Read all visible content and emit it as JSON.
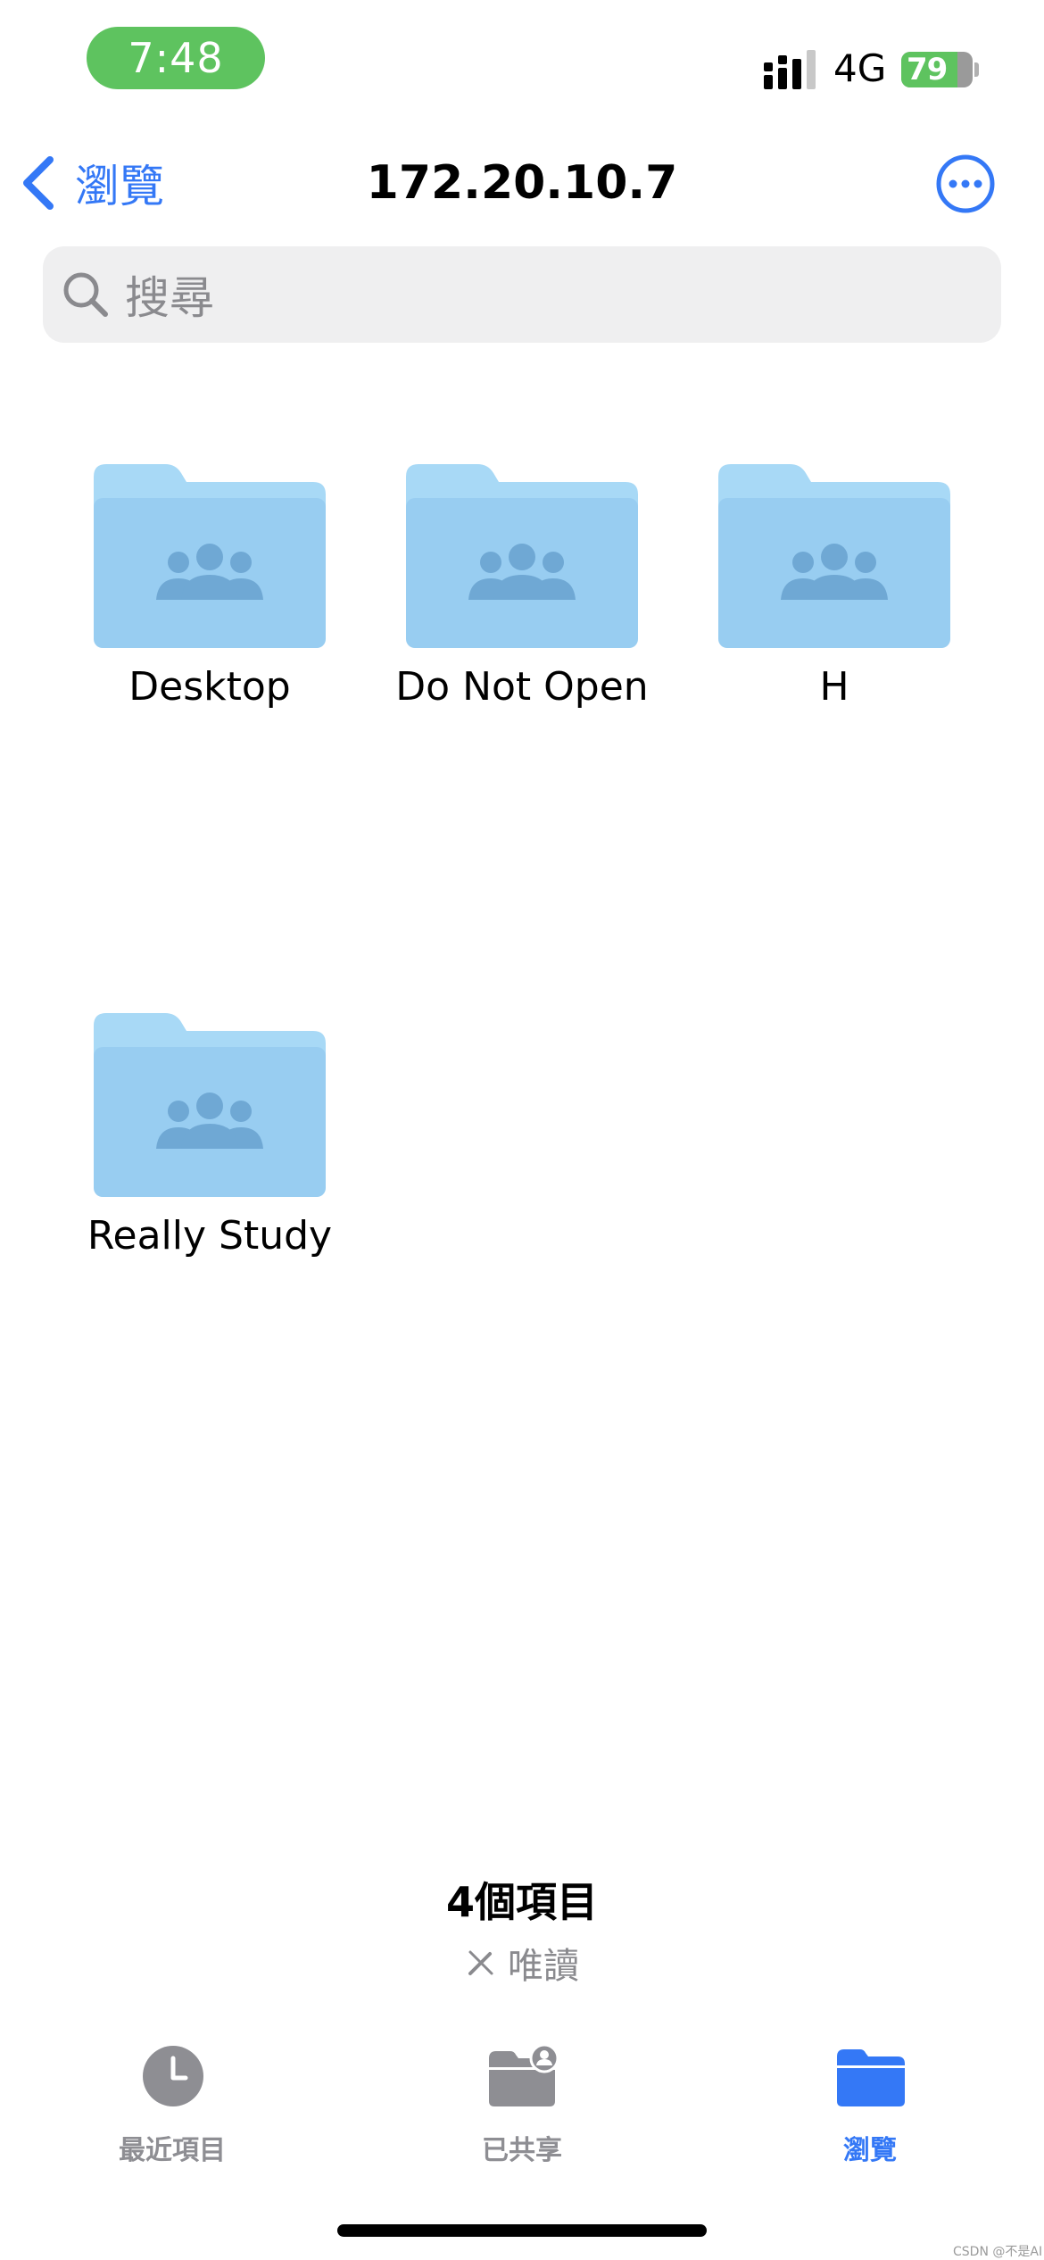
{
  "status_bar": {
    "time": "7:48",
    "network": "4G",
    "battery_percent": 79,
    "battery_label": "79",
    "colors": {
      "time_pill": "#5ec35f",
      "battery": "#5ec35f"
    }
  },
  "nav": {
    "back_label": "瀏覽",
    "title": "172.20.10.7",
    "more_icon": "ellipsis-circle-icon"
  },
  "search": {
    "placeholder": "搜尋"
  },
  "folders": [
    {
      "name": "Desktop",
      "icon": "shared-folder-icon"
    },
    {
      "name": "Do Not Open",
      "icon": "shared-folder-icon"
    },
    {
      "name": "H",
      "icon": "shared-folder-icon"
    },
    {
      "name": "Really Study",
      "icon": "shared-folder-icon"
    }
  ],
  "footer": {
    "items_count": "4個項目",
    "read_only": "唯讀"
  },
  "tab_bar": {
    "tabs": [
      {
        "label": "最近項目",
        "icon": "clock-icon",
        "active": false
      },
      {
        "label": "已共享",
        "icon": "shared-folder-icon",
        "active": false
      },
      {
        "label": "瀏覽",
        "icon": "folder-icon",
        "active": true
      }
    ]
  },
  "watermark": "CSDN @不是AI",
  "theme": {
    "accent": "#3478f6",
    "folder_back": "#a6d7f5",
    "folder_front": "#98cdf1",
    "inactive_tab": "#8e8e93"
  }
}
